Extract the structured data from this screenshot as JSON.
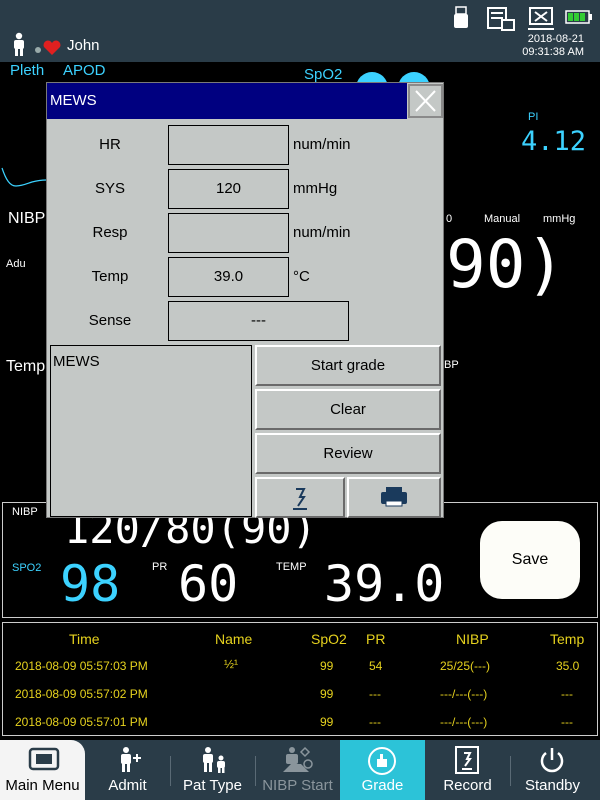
{
  "statusbar": {
    "patient_name": "John",
    "date": "2018-08-21",
    "time": "09:31:38 AM"
  },
  "monitor": {
    "pleth_label": "Pleth",
    "apod_label": "APOD",
    "spo2_label": "SpO2",
    "pi_label": "PI",
    "pi_value": "4.12",
    "nibp_label": "NIBP",
    "adu_label": "Adu",
    "nibp_partial_digit": "0",
    "manual_label": "Manual",
    "mmhg_label": "mmHg",
    "nibp_map_partial": "90)",
    "temp_label": "Temp",
    "bp_partial": "BP"
  },
  "dialog": {
    "title": "MEWS",
    "rows": [
      {
        "label": "HR",
        "value": "",
        "unit": "num/min"
      },
      {
        "label": "SYS",
        "value": "120",
        "unit": "mmHg"
      },
      {
        "label": "Resp",
        "value": "",
        "unit": "num/min"
      },
      {
        "label": "Temp",
        "value": "39.0",
        "unit": "°C"
      },
      {
        "label": "Sense",
        "value": "---",
        "unit": ""
      }
    ],
    "result_label": "MEWS",
    "start_grade": "Start grade",
    "clear": "Clear",
    "review": "Review"
  },
  "vitals": {
    "nibp_label": "NIBP",
    "nibp_value": "120/80(90)",
    "spo2_label": "SPO2",
    "spo2_value": "98",
    "pr_label": "PR",
    "pr_value": "60",
    "temp_label": "TEMP",
    "temp_value": "39.0",
    "save_label": "Save"
  },
  "history": {
    "headers": [
      "Time",
      "Name",
      "SpO2",
      "PR",
      "NIBP",
      "Temp"
    ],
    "rows": [
      [
        "2018-08-09 05:57:03 PM",
        "½¹",
        "99",
        "54",
        "25/25(---)",
        "35.0"
      ],
      [
        "2018-08-09 05:57:02 PM",
        "",
        "99",
        "---",
        "---/---(---)",
        "---"
      ],
      [
        "2018-08-09 05:57:01 PM",
        "",
        "99",
        "---",
        "---/---(---)",
        "---"
      ]
    ]
  },
  "nav": {
    "main_menu": "Main Menu",
    "admit": "Admit",
    "pat_type": "Pat Type",
    "nibp_start": "NIBP Start",
    "grade": "Grade",
    "record": "Record",
    "standby": "Standby"
  },
  "colors": {
    "accent_cyan": "#3cd2ff",
    "table_yellow": "#e6d21e",
    "grade_active": "#2cc3d8",
    "dialog_title_bg": "#000080"
  }
}
